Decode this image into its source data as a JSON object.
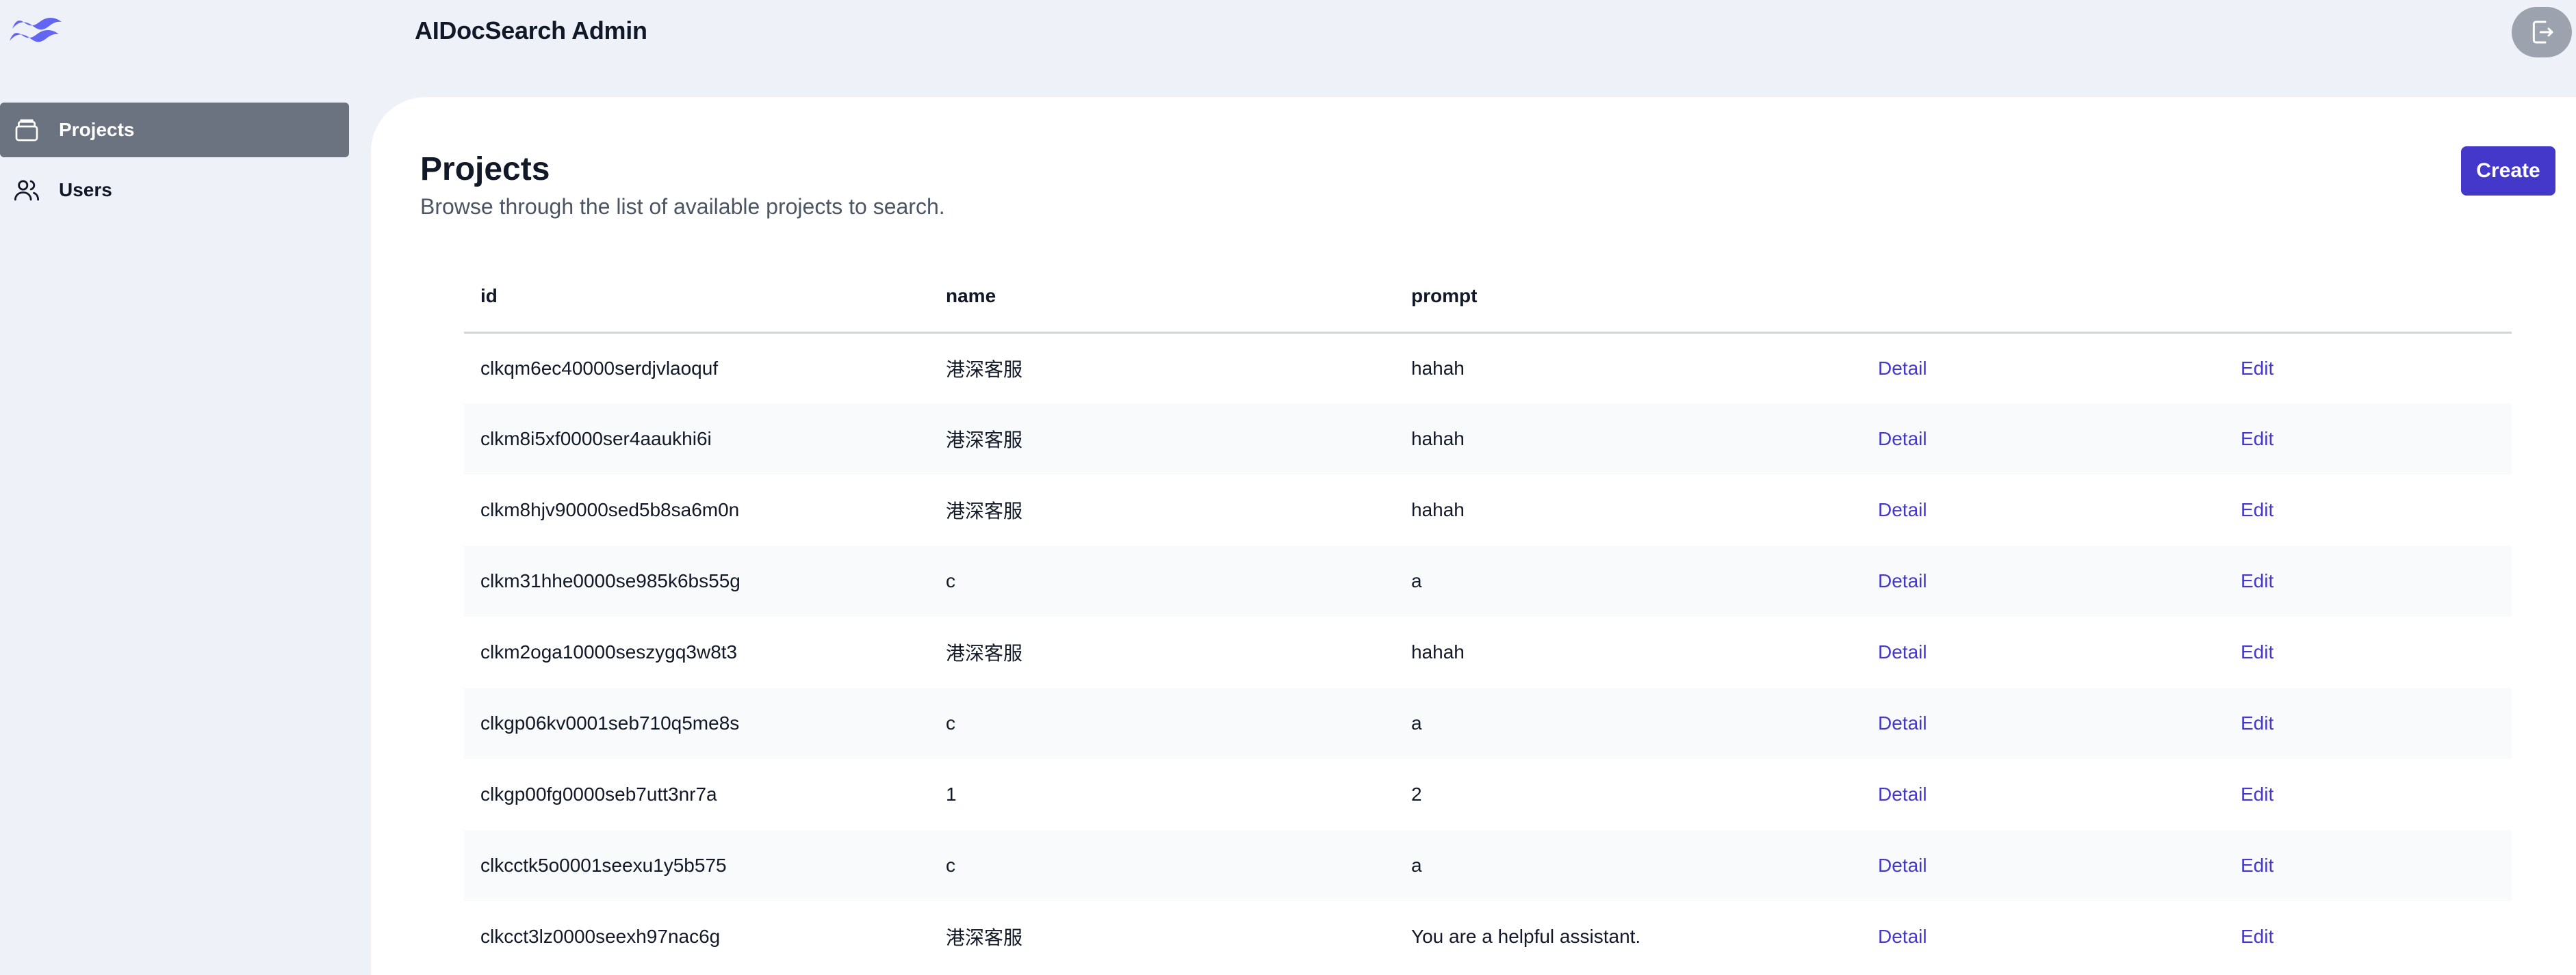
{
  "header": {
    "app_title": "AIDocSearch Admin"
  },
  "sidebar": {
    "items": [
      {
        "label": "Projects",
        "icon": "folder-icon",
        "active": true
      },
      {
        "label": "Users",
        "icon": "users-icon",
        "active": false
      }
    ]
  },
  "main": {
    "title": "Projects",
    "subtitle": "Browse through the list of available projects to search.",
    "create_label": "Create"
  },
  "table": {
    "columns": [
      "id",
      "name",
      "prompt"
    ],
    "detail_label": "Detail",
    "edit_label": "Edit",
    "rows": [
      {
        "id": "clkqm6ec40000serdjvlaoquf",
        "name": "港深客服",
        "prompt": "hahah"
      },
      {
        "id": "clkm8i5xf0000ser4aaukhi6i",
        "name": "港深客服",
        "prompt": "hahah"
      },
      {
        "id": "clkm8hjv90000sed5b8sa6m0n",
        "name": "港深客服",
        "prompt": "hahah"
      },
      {
        "id": "clkm31hhe0000se985k6bs55g",
        "name": "c",
        "prompt": "a"
      },
      {
        "id": "clkm2oga10000seszygq3w8t3",
        "name": "港深客服",
        "prompt": "hahah"
      },
      {
        "id": "clkgp06kv0001seb710q5me8s",
        "name": "c",
        "prompt": "a"
      },
      {
        "id": "clkgp00fg0000seb7utt3nr7a",
        "name": "1",
        "prompt": "2"
      },
      {
        "id": "clkcctk5o0001seexu1y5b575",
        "name": "c",
        "prompt": "a"
      },
      {
        "id": "clkcct3lz0000seexh97nac6g",
        "name": "港深客服",
        "prompt": "You are a helpful assistant."
      }
    ]
  },
  "colors": {
    "accent": "#4338ca",
    "sidebar_active": "#6b7280",
    "page_bg": "#eef2f8"
  }
}
